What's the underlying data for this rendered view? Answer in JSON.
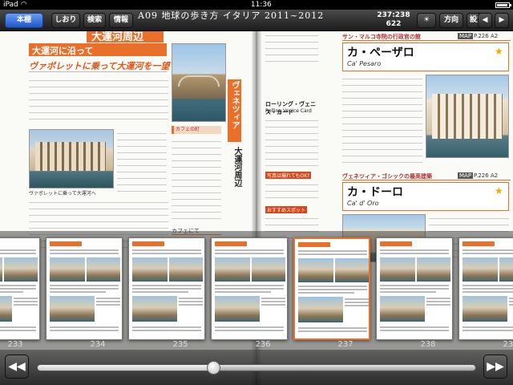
{
  "status": {
    "device": "iPad",
    "time": "11:36",
    "battery_fraction": 0.92
  },
  "toolbar": {
    "library_label": "本棚",
    "bookmark_label": "しおり",
    "search_label": "検索",
    "info_label": "情報",
    "title": "A09 地球の歩き方 イタリア 2011~2012",
    "coords_top": "237:238",
    "coords_bottom": "622",
    "brightness_icon": "sun-icon",
    "direction_label": "方向",
    "settings_label": "設定",
    "prev_icon": "triangle-left-icon",
    "next_icon": "triangle-right-icon"
  },
  "left_page": {
    "page_title": "大運河周辺",
    "section_heading": "大運河に沿って",
    "subheading": "ヴァポレットに乗って大運河を一望する",
    "side_tab": "ヴェネツィア",
    "vertical_label": "大運河周辺",
    "box_heading": "カフェの町",
    "caption": "ヴァポレットに乗って大運河へ",
    "cafe_label": "カフェにて"
  },
  "right_page": {
    "palace_section": "サン・マルコ寺院の行政官の館",
    "entry1_name": "カ・ペーザロ",
    "entry1_latin": "Ca' Pesaro",
    "entry1_ref": "P.226 A2",
    "gothic_section": "ヴェネツィア・ゴシックの最高建築",
    "entry2_name": "カ・ドーロ",
    "entry2_latin": "Ca' d' Oro",
    "entry2_ref": "P.226 A2",
    "side_heading1": "ローリング・ヴェニス・カード",
    "side_heading1_latin": "Rolling Venice Card",
    "tag1": "写真は撮れてもOK?",
    "tag2": "おすすめスポット"
  },
  "thumbnails": {
    "page_numbers": [
      "233",
      "234",
      "235",
      "236",
      "237",
      "238",
      "239"
    ],
    "selected_index": 4
  },
  "slider": {
    "position_fraction": 0.4,
    "prev_icon": "double-chevron-left-icon",
    "next_icon": "double-chevron-right-icon"
  },
  "colors": {
    "accent_orange": "#e8702a",
    "toolbar_blue": "#2257c9"
  }
}
